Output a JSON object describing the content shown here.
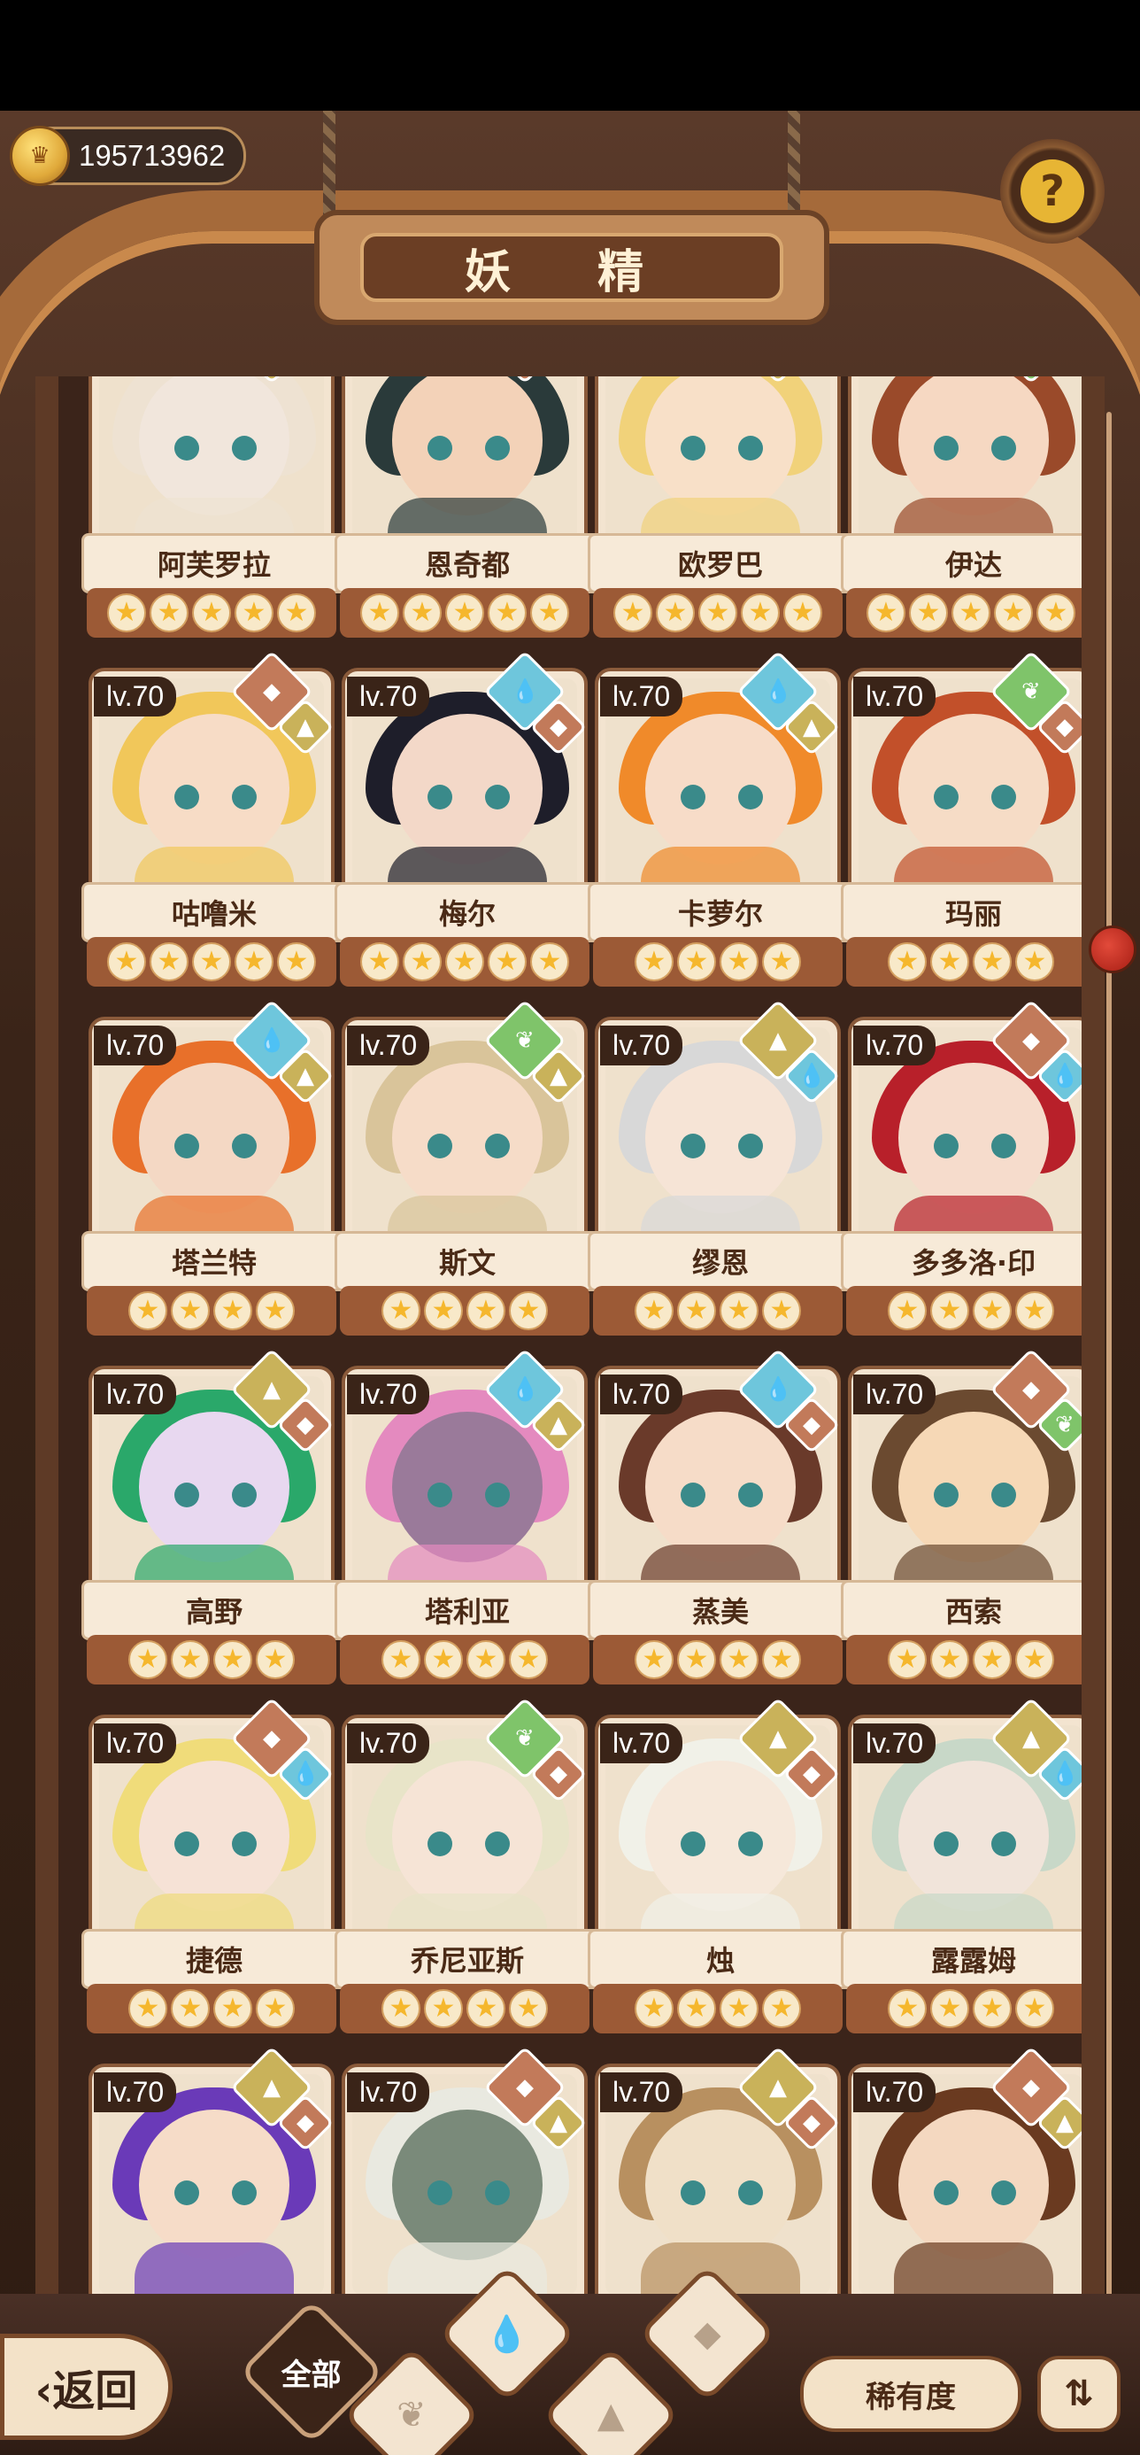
{
  "currency": {
    "value": "195713962",
    "icon": "crown-coin-icon"
  },
  "header": {
    "title": "妖 精",
    "help_icon": "question-sprout-icon"
  },
  "colors": {
    "element_earth": "#c27a5a",
    "element_grass": "#7fc46a",
    "element_water": "#6ec6dc",
    "element_gold": "#c9b25a"
  },
  "fairies": [
    {
      "name": "阿芙罗拉",
      "level": "",
      "stars": "★★★★★",
      "elements": [
        "gold"
      ]
    },
    {
      "name": "恩奇都",
      "level": "",
      "stars": "★★★★★",
      "elements": [
        "earth"
      ]
    },
    {
      "name": "欧罗巴",
      "level": "",
      "stars": "★★★★★",
      "elements": [
        "gold"
      ]
    },
    {
      "name": "伊达",
      "level": "",
      "stars": "★★★★★",
      "elements": [
        "grass"
      ]
    },
    {
      "name": "咕噜米",
      "level": "lv.70",
      "stars": "★★★★★",
      "elements": [
        "earth",
        "gold"
      ]
    },
    {
      "name": "梅尔",
      "level": "lv.70",
      "stars": "★★★★★",
      "elements": [
        "water",
        "earth"
      ]
    },
    {
      "name": "卡萝尔",
      "level": "lv.70",
      "stars": "★★★★",
      "elements": [
        "water",
        "gold"
      ]
    },
    {
      "name": "玛丽",
      "level": "lv.70",
      "stars": "★★★★",
      "elements": [
        "grass",
        "earth"
      ]
    },
    {
      "name": "塔兰特",
      "level": "lv.70",
      "stars": "★★★★",
      "elements": [
        "water",
        "gold"
      ]
    },
    {
      "name": "斯文",
      "level": "lv.70",
      "stars": "★★★★",
      "elements": [
        "grass",
        "gold"
      ]
    },
    {
      "name": "缪恩",
      "level": "lv.70",
      "stars": "★★★★",
      "elements": [
        "gold",
        "water"
      ]
    },
    {
      "name": "多多洛·印",
      "level": "lv.70",
      "stars": "★★★★",
      "elements": [
        "earth",
        "water"
      ]
    },
    {
      "name": "高野",
      "level": "lv.70",
      "stars": "★★★★",
      "elements": [
        "gold",
        "earth"
      ]
    },
    {
      "name": "塔利亚",
      "level": "lv.70",
      "stars": "★★★★",
      "elements": [
        "water",
        "gold"
      ]
    },
    {
      "name": "蒸美",
      "level": "lv.70",
      "stars": "★★★★",
      "elements": [
        "water",
        "earth"
      ]
    },
    {
      "name": "西索",
      "level": "lv.70",
      "stars": "★★★★",
      "elements": [
        "earth",
        "grass"
      ]
    },
    {
      "name": "捷德",
      "level": "lv.70",
      "stars": "★★★★",
      "elements": [
        "earth",
        "water"
      ]
    },
    {
      "name": "乔尼亚斯",
      "level": "lv.70",
      "stars": "★★★★",
      "elements": [
        "grass",
        "earth"
      ]
    },
    {
      "name": "烛",
      "level": "lv.70",
      "stars": "★★★★",
      "elements": [
        "gold",
        "earth"
      ]
    },
    {
      "name": "露露姆",
      "level": "lv.70",
      "stars": "★★★★",
      "elements": [
        "gold",
        "water"
      ]
    },
    {
      "name": "",
      "level": "lv.70",
      "stars": "",
      "elements": [
        "gold",
        "earth"
      ]
    },
    {
      "name": "",
      "level": "lv.70",
      "stars": "",
      "elements": [
        "earth",
        "gold"
      ]
    },
    {
      "name": "",
      "level": "lv.70",
      "stars": "",
      "elements": [
        "gold",
        "earth"
      ]
    },
    {
      "name": "",
      "level": "lv.70",
      "stars": "",
      "elements": [
        "earth",
        "gold"
      ]
    }
  ],
  "bottom_bar": {
    "back_label": "‹返回",
    "filter_all": "全部",
    "filter_icons": [
      "water-drop-icon",
      "sprout-icon",
      "mountain-icon",
      "rock-icon"
    ],
    "sort_label": "稀有度",
    "order_icon": "sort-order-icon"
  }
}
